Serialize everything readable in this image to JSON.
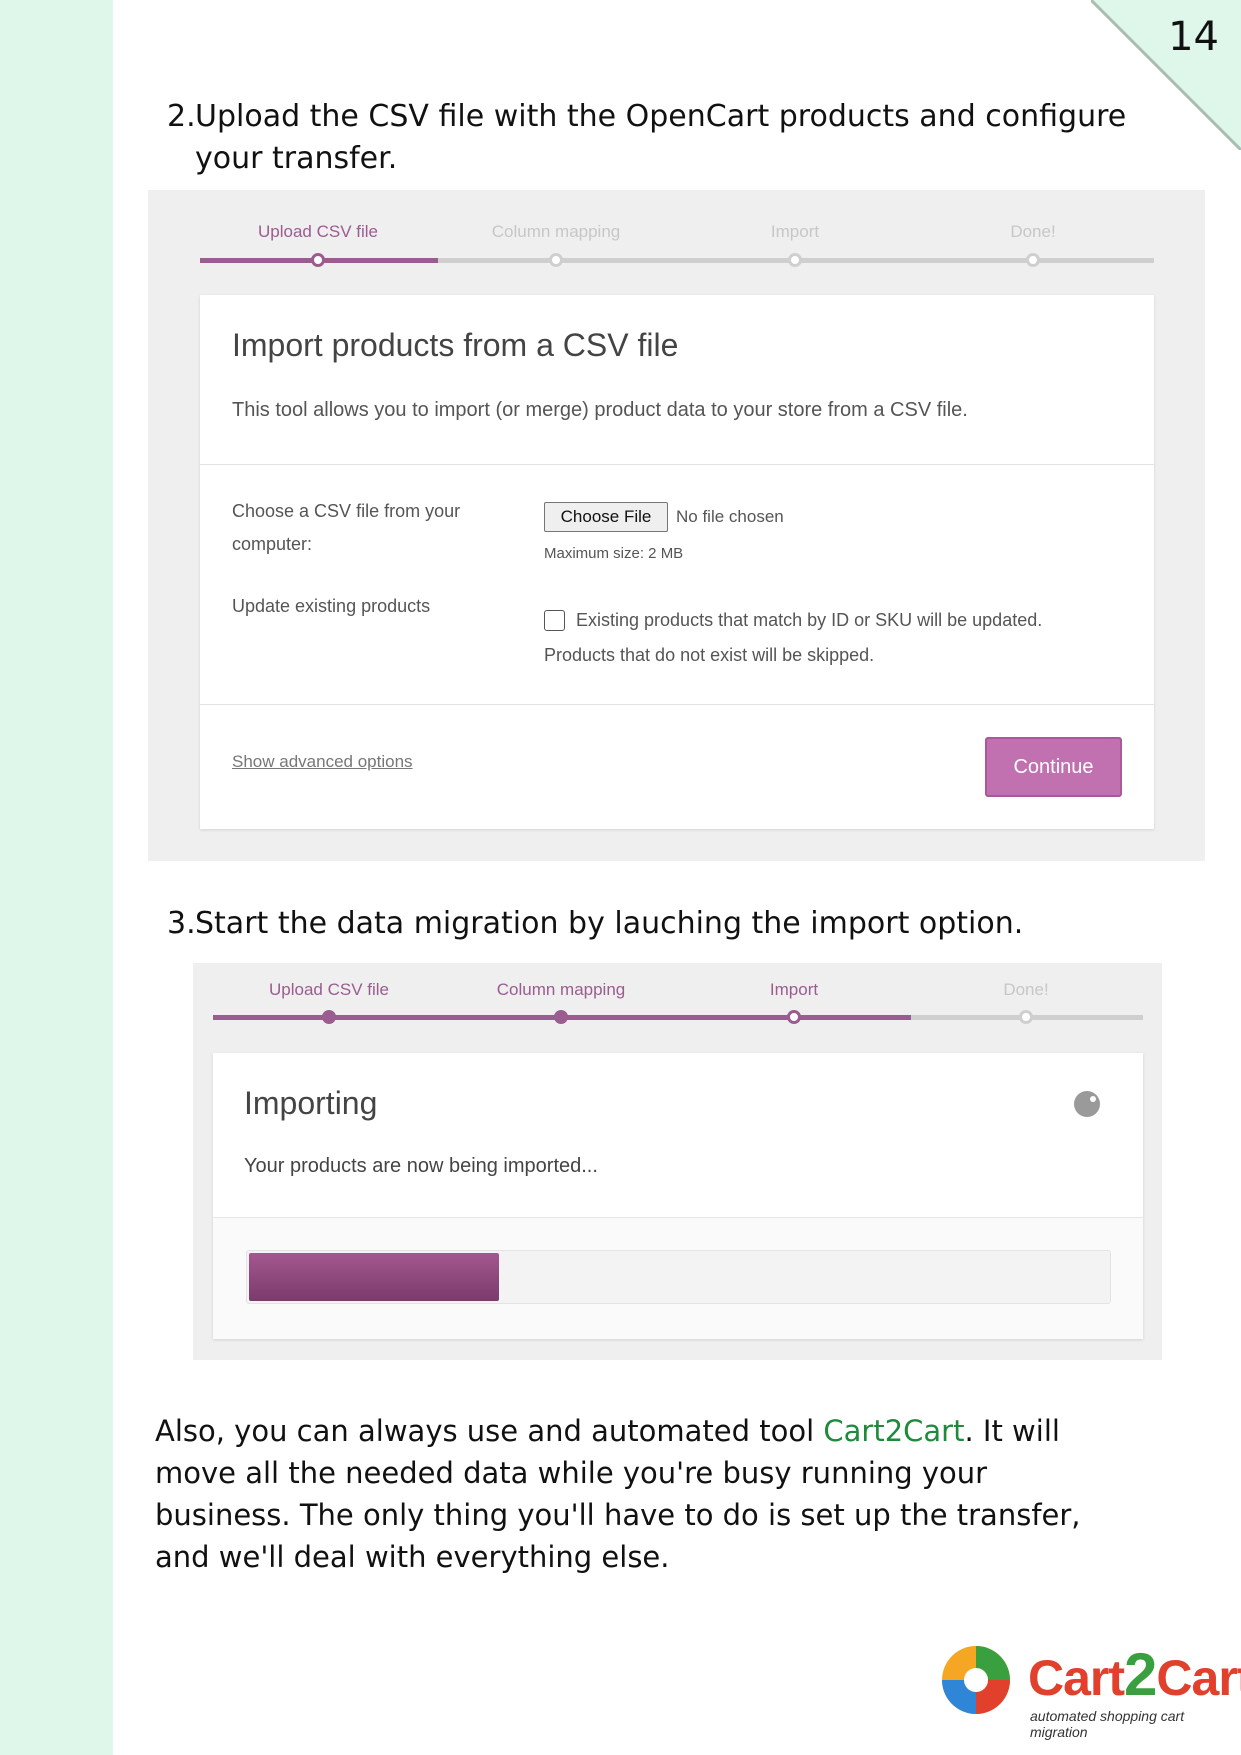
{
  "page_number": "14",
  "step2": {
    "number": "2.",
    "text": "Upload the CSV file with the OpenCart products and configure your transfer."
  },
  "screenshot1": {
    "steps": [
      "Upload CSV file",
      "Column mapping",
      "Import",
      "Done!"
    ],
    "title": "Import products from a CSV file",
    "description": "This tool allows you to import (or merge) product data to your store from a CSV file.",
    "file_label": "Choose a CSV file from your computer:",
    "choose_file_button": "Choose File",
    "no_file_text": "No file chosen",
    "max_size": "Maximum size: 2 MB",
    "update_label": "Update existing products",
    "update_text1": "Existing products that match by ID or SKU will be updated.",
    "update_text2": "Products that do not exist will be skipped.",
    "advanced_link": "Show advanced options",
    "continue_button": "Continue"
  },
  "step3": {
    "number": "3.",
    "text": "Start the data migration by lauching the import option."
  },
  "screenshot2": {
    "steps": [
      "Upload CSV file",
      "Column mapping",
      "Import",
      "Done!"
    ],
    "title": "Importing",
    "description": "Your products are now being imported...",
    "progress": 0.29
  },
  "paragraph": {
    "before": "Also, you can always use and automated tool ",
    "link": "Cart2Cart",
    "after": ". It will move all the needed data while you're busy running your business. The only thing you'll have to do is set up the transfer, and we'll deal with everything else."
  },
  "logo": {
    "part1": "Cart",
    "part2": "2",
    "part3": "Cart",
    "tagline": "automated shopping cart migration"
  },
  "colors": {
    "accent": "#9b5c8f",
    "continue_button": "#c170b0",
    "link_green": "#1e8a3c",
    "side_strip": "#dff7ea"
  }
}
